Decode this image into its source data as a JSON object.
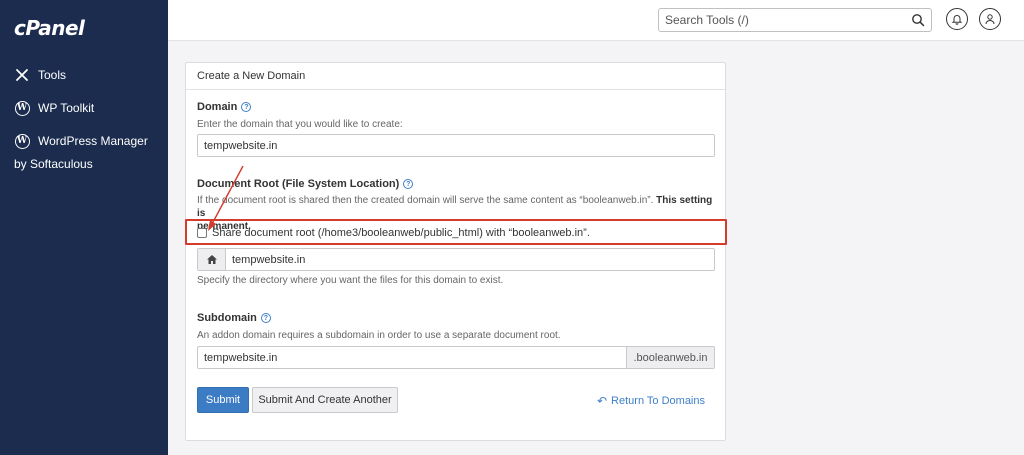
{
  "app": {
    "logo": "cPanel"
  },
  "sidebar": {
    "items": [
      {
        "label": "Tools",
        "icon": "tools-icon"
      },
      {
        "label": "WP Toolkit",
        "icon": "wordpress-icon"
      },
      {
        "label": "WordPress Manager",
        "label2": "by Softaculous",
        "icon": "wordpress-icon"
      }
    ]
  },
  "header": {
    "search_placeholder": "Search Tools (/)"
  },
  "form": {
    "title": "Create a New Domain",
    "domain": {
      "label": "Domain",
      "desc": "Enter the domain that you would like to create:",
      "value": "tempwebsite.in"
    },
    "docroot": {
      "label": "Document Root (File System Location)",
      "desc_line1": "If the document root is shared then the created domain will serve the same content as “booleanweb.in”.",
      "desc_bold1": "This setting is",
      "desc_bold2": "permanent.",
      "share_label": "Share document root (/home3/booleanweb/public_html) with “booleanweb.in”.",
      "share_checked": false,
      "value": "tempwebsite.in",
      "hint": "Specify the directory where you want the files for this domain to exist."
    },
    "subdomain": {
      "label": "Subdomain",
      "desc": "An addon domain requires a subdomain in order to use a separate document root.",
      "value": "tempwebsite.in",
      "suffix": ".booleanweb.in"
    },
    "buttons": {
      "submit": "Submit",
      "submit_another": "Submit And Create Another",
      "return": "Return To Domains"
    }
  },
  "colors": {
    "sidebar_bg": "#1b2c4e",
    "accent": "#3c7cc4",
    "annotation": "#d33c2c"
  }
}
